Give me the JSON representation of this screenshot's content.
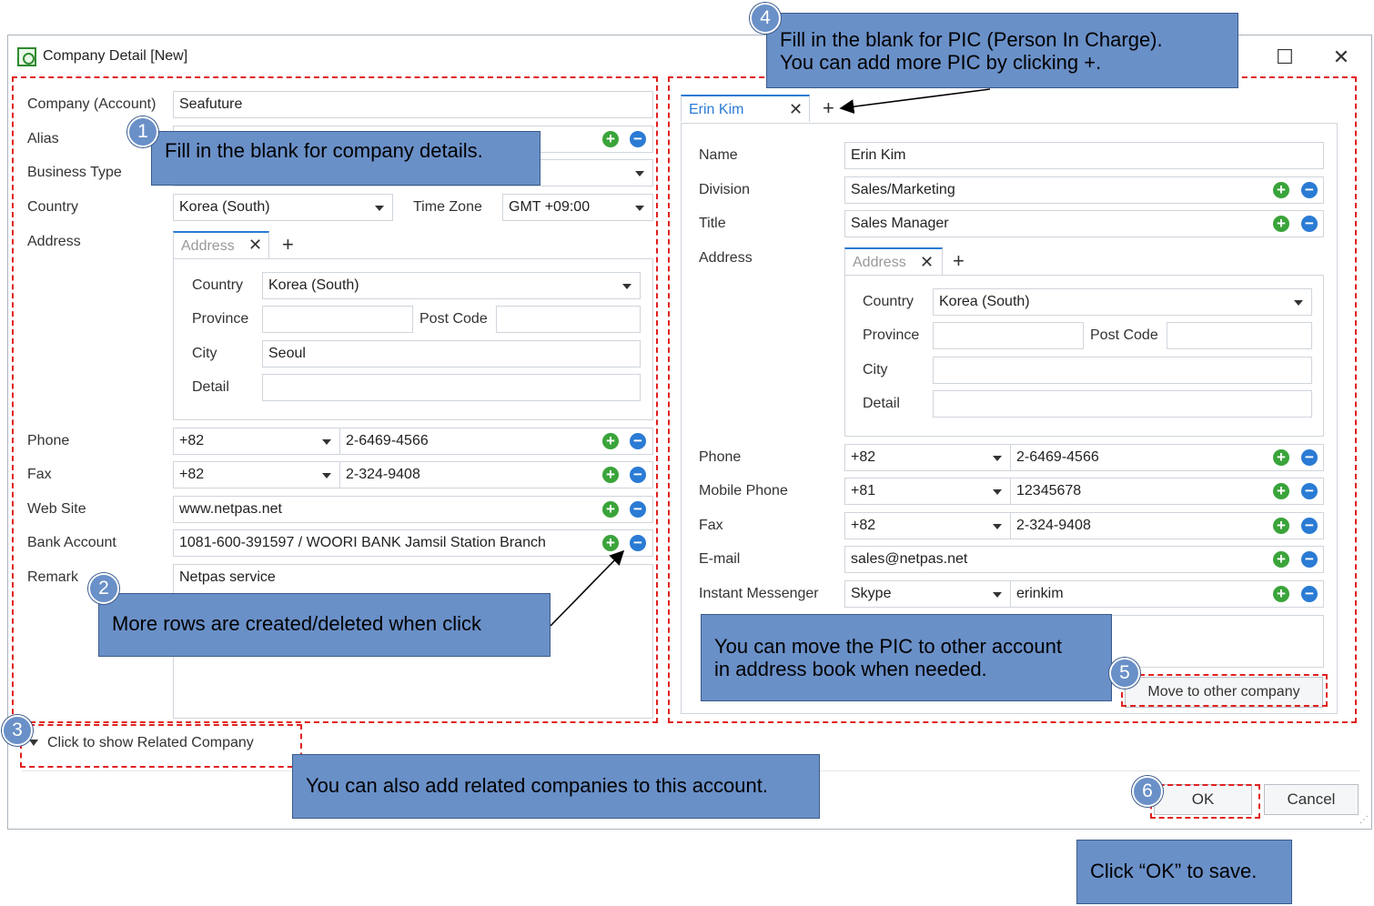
{
  "window": {
    "title": "Company Detail [New]",
    "maximize_icon": "maximize-icon",
    "close_icon": "close-icon"
  },
  "company": {
    "labels": {
      "company": "Company (Account)",
      "alias": "Alias",
      "business_type": "Business Type",
      "country": "Country",
      "time_zone": "Time Zone",
      "address": "Address",
      "phone": "Phone",
      "fax": "Fax",
      "web_site": "Web Site",
      "bank_account": "Bank Account",
      "remark": "Remark"
    },
    "company_value": "Seafuture",
    "alias_value": "",
    "business_type_value": "",
    "country_value": "Korea (South)",
    "time_zone_value": "GMT +09:00",
    "address_tab": {
      "tab_label": "Address",
      "add_tab": "+",
      "labels": {
        "country": "Country",
        "province": "Province",
        "post_code": "Post Code",
        "city": "City",
        "detail": "Detail"
      },
      "country_value": "Korea (South)",
      "province_value": "",
      "post_code_value": "",
      "city_value": "Seoul",
      "detail_value": ""
    },
    "phone_code": "+82",
    "phone_value": "2-6469-4566",
    "fax_code": "+82",
    "fax_value": "2-324-9408",
    "web_site_value": "www.netpas.net",
    "bank_account_value": "1081-600-391597 / WOORI BANK Jamsil Station Branch",
    "remark_value": "Netpas service"
  },
  "pic": {
    "tab_label": "Erin Kim",
    "add_tab": "+",
    "labels": {
      "name": "Name",
      "division": "Division",
      "title": "Title",
      "address": "Address",
      "phone": "Phone",
      "mobile": "Mobile Phone",
      "fax": "Fax",
      "email": "E-mail",
      "im": "Instant Messenger"
    },
    "name_value": "Erin Kim",
    "division_value": "Sales/Marketing",
    "title_value": "Sales Manager",
    "address_tab": {
      "tab_label": "Address",
      "add_tab": "+",
      "labels": {
        "country": "Country",
        "province": "Province",
        "post_code": "Post Code",
        "city": "City",
        "detail": "Detail"
      },
      "country_value": "Korea (South)",
      "province_value": "",
      "post_code_value": "",
      "city_value": "",
      "detail_value": ""
    },
    "phone_code": "+82",
    "phone_value": "2-6469-4566",
    "mobile_code": "+81",
    "mobile_value": "12345678",
    "fax_code": "+82",
    "fax_value": "2-324-9408",
    "email_value": "sales@netpas.net",
    "im_type": "Skype",
    "im_value": "erinkim",
    "move_button": "Move to other company"
  },
  "related": {
    "toggle_label": "Click to show Related Company"
  },
  "footer": {
    "ok": "OK",
    "cancel": "Cancel"
  },
  "callouts": {
    "c1": {
      "num": "1",
      "text": "Fill in the blank for company details."
    },
    "c2": {
      "num": "2",
      "text": "More rows are created/deleted when click"
    },
    "c3": {
      "num": "3",
      "text": "You can also add related companies to this account."
    },
    "c4": {
      "num": "4",
      "line1": "Fill in the blank for PIC (Person In Charge).",
      "line2": "You can add more PIC by clicking +."
    },
    "c5": {
      "num": "5",
      "line1": "You can move the PIC to other account",
      "line2": "in address book when needed."
    },
    "c6": {
      "num": "6",
      "text": "Click “OK” to save."
    }
  },
  "colors": {
    "callout_bg": "#6a90c8",
    "dashed": "#e02020",
    "plus": "#3aa43a",
    "minus": "#2a7bd4"
  }
}
